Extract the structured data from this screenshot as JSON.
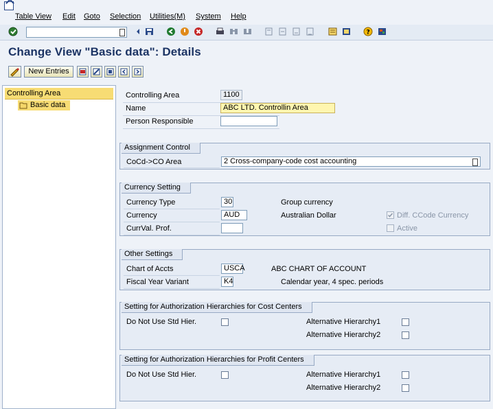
{
  "menu": {
    "items": [
      "Table View",
      "Edit",
      "Goto",
      "Selection",
      "Utilities(M)",
      "System",
      "Help"
    ]
  },
  "toolbar": {
    "command_value": ""
  },
  "page": {
    "title": "Change View \"Basic data\": Details"
  },
  "app_toolbar": {
    "new_entries": "New Entries"
  },
  "tree": {
    "root": "Controlling Area",
    "child": "Basic data"
  },
  "header_fields": {
    "controlling_area_label": "Controlling Area",
    "controlling_area_value": "1100",
    "name_label": "Name",
    "name_value": "ABC LTD. Controllin Area",
    "person_label": "Person Responsible",
    "person_value": ""
  },
  "assignment": {
    "title": "Assignment Control",
    "cocd_label": "CoCd->CO Area",
    "cocd_value": "2 Cross-company-code cost accounting"
  },
  "currency": {
    "title": "Currency Setting",
    "type_label": "Currency Type",
    "type_value": "30",
    "type_text": "Group currency",
    "currency_label": "Currency",
    "currency_value": "AUD",
    "currency_text": "Australian Dollar",
    "profile_label": "CurrVal. Prof.",
    "profile_value": "",
    "diff_label": "Diff. CCode Currency",
    "diff_checked": true,
    "active_label": "Active",
    "active_checked": false
  },
  "other": {
    "title": "Other Settings",
    "coa_label": "Chart of Accts",
    "coa_value": "USCA",
    "coa_text": "ABC CHART OF ACCOUNT",
    "fyv_label": "Fiscal Year Variant",
    "fyv_value": "K4",
    "fyv_text": "Calendar year, 4 spec. periods"
  },
  "auth_cc": {
    "title": "Setting for Authorization Hierarchies for Cost Centers",
    "std_label": "Do Not Use Std Hier.",
    "alt1_label": "Alternative Hierarchy1",
    "alt2_label": "Alternative Hierarchy2"
  },
  "auth_pc": {
    "title": "Setting for Authorization Hierarchies for Profit Centers",
    "std_label": "Do Not Use Std Hier.",
    "alt1_label": "Alternative Hierarchy1",
    "alt2_label": "Alternative Hierarchy2"
  },
  "colors": {
    "title": "#1c3464",
    "highlight": "#f7dc74",
    "accent_blue": "#2a4a8a"
  }
}
